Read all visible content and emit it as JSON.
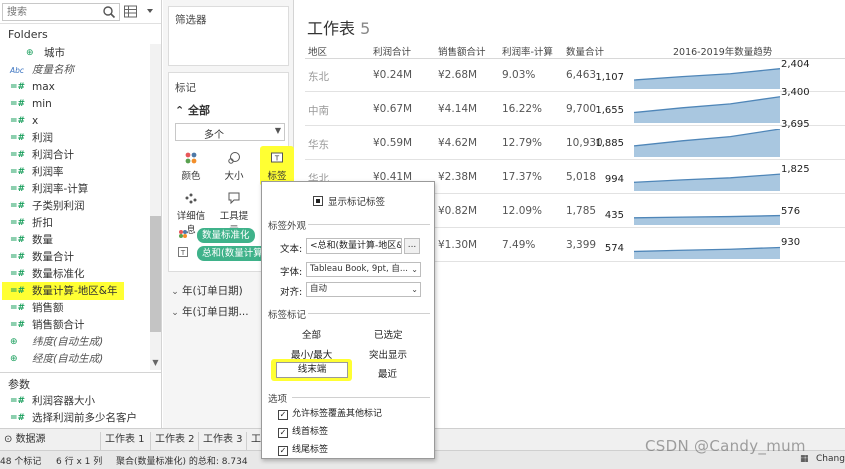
{
  "data_pane": {
    "search_placeholder": "搜索",
    "folders_heading": "Folders",
    "fields": [
      {
        "icon": "globe",
        "label": "城市"
      },
      {
        "icon": "abc",
        "label": "度量名称"
      },
      {
        "icon": "hash",
        "label": "max"
      },
      {
        "icon": "hash",
        "label": "min"
      },
      {
        "icon": "hash",
        "label": "x"
      },
      {
        "icon": "hash",
        "label": "利润"
      },
      {
        "icon": "hash",
        "label": "利润合计"
      },
      {
        "icon": "hash",
        "label": "利润率"
      },
      {
        "icon": "hash",
        "label": "利润率-计算"
      },
      {
        "icon": "hash",
        "label": "子类别利润"
      },
      {
        "icon": "hash",
        "label": "折扣"
      },
      {
        "icon": "hash",
        "label": "数量"
      },
      {
        "icon": "hash",
        "label": "数量合计"
      },
      {
        "icon": "hash",
        "label": "数量标准化"
      },
      {
        "icon": "hash",
        "label": "数量计算-地区&年"
      },
      {
        "icon": "hash",
        "label": "销售额"
      },
      {
        "icon": "hash",
        "label": "销售额合计"
      },
      {
        "icon": "globe",
        "label": "纬度(自动生成)"
      },
      {
        "icon": "globe",
        "label": "经度(自动生成)"
      }
    ],
    "params_heading": "参数",
    "params": [
      {
        "icon": "hash",
        "label": "利润容器大小"
      },
      {
        "icon": "hash",
        "label": "选择利润前多少名客户"
      }
    ]
  },
  "shelves": {
    "filters_title": "筛选器",
    "marks_title": "标记",
    "marks_all": "全部",
    "mark_type": "多个",
    "buttons": [
      {
        "icon": "color-icon",
        "label": "颜色"
      },
      {
        "icon": "size-icon",
        "label": "大小"
      },
      {
        "icon": "label-icon",
        "label": "标签"
      },
      {
        "icon": "detail-icon",
        "label": "详细信息"
      },
      {
        "icon": "tooltip-icon",
        "label": "工具提示"
      }
    ],
    "pill_color": "数量标准化",
    "pill_label": "总和(数量计算",
    "date_pills": [
      "年(订单日期)",
      "年(订单日期..."
    ]
  },
  "view": {
    "title": "工作表",
    "title_num": "5",
    "headers": [
      "地区",
      "利润合计",
      "销售额合计",
      "利润率-计算",
      "数量合计",
      "2016-2019年数量趋势"
    ],
    "rows": [
      {
        "region": "东北",
        "profit": "¥0.24M",
        "sales": "¥2.68M",
        "rate": "9.03%",
        "qty": "6,463",
        "spark_start": "1,107",
        "spark_end": "2,404"
      },
      {
        "region": "中南",
        "profit": "¥0.67M",
        "sales": "¥4.14M",
        "rate": "16.22%",
        "qty": "9,700",
        "spark_start": "1,655",
        "spark_end": "3,400"
      },
      {
        "region": "华东",
        "profit": "¥0.59M",
        "sales": "¥4.62M",
        "rate": "12.79%",
        "qty": "10,930",
        "spark_start": "1,885",
        "spark_end": "3,695"
      },
      {
        "region": "华北",
        "profit": "¥0.41M",
        "sales": "¥2.38M",
        "rate": "17.37%",
        "qty": "5,018",
        "spark_start": "994",
        "spark_end": "1,825"
      },
      {
        "region": "",
        "profit": "",
        "sales": "¥0.82M",
        "rate": "12.09%",
        "qty": "1,785",
        "spark_start": "435",
        "spark_end": "576"
      },
      {
        "region": "",
        "profit": "",
        "sales": "¥1.30M",
        "rate": "7.49%",
        "qty": "3,399",
        "spark_start": "574",
        "spark_end": "930"
      }
    ]
  },
  "dialog": {
    "show_labels": "显示标记标签",
    "appearance_heading": "标签外观",
    "text_label": "文本:",
    "text_value": "<总和(数量计算-地区&",
    "text_more": "...",
    "font_label": "字体:",
    "font_value": "Tableau Book, 9pt, 自...",
    "align_label": "对齐:",
    "align_value": "自动",
    "marks_heading": "标签标记",
    "opt_all": "全部",
    "opt_selected": "已选定",
    "opt_minmax": "最小/最大",
    "opt_highlight": "突出显示",
    "opt_line_end": "线末端",
    "opt_recent": "最近",
    "options_heading": "选项",
    "chk_overlap": "允许标签覆盖其他标记",
    "chk_line_start": "线首标签",
    "chk_line_end": "线尾标签"
  },
  "tabs": {
    "datasource": "数据源",
    "sheets": [
      "工作表 1",
      "工作表 2",
      "工作表 3",
      "工"
    ]
  },
  "status": {
    "marks": "48 个标记",
    "dims": "6 行 x 1 列",
    "sum": "聚合(数量标准化) 的总和: 8.734",
    "change": "Chang"
  },
  "watermark": "CSDN @Candy_mum",
  "colors": {
    "accent_green": "#3fb28a",
    "highlight_yellow": "#ffff33",
    "sparkline_fill": "#a9c7e0",
    "sparkline_line": "#4f86b8"
  }
}
